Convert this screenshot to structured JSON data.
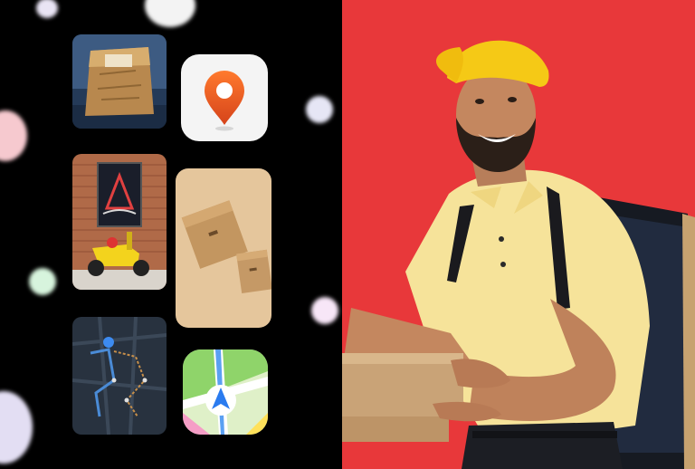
{
  "colors": {
    "background": "#000000",
    "hero_red": "#e8383a",
    "pin_orange": "#e85a1c",
    "cap_yellow": "#f5c916",
    "shirt_yellow": "#f6e39a",
    "box_kraft": "#c69c6a",
    "map_dark": "#2a3340"
  },
  "icons": {
    "location_pin": "location-pin-icon",
    "navigation_arrow": "navigation-arrow-icon"
  },
  "photos": {
    "paper_bag": "paper-bag-photo",
    "scooter": "delivery-scooter-photo",
    "boxes": "cardboard-boxes-photo",
    "map": "route-map-photo",
    "courier": "delivery-man-photo"
  }
}
